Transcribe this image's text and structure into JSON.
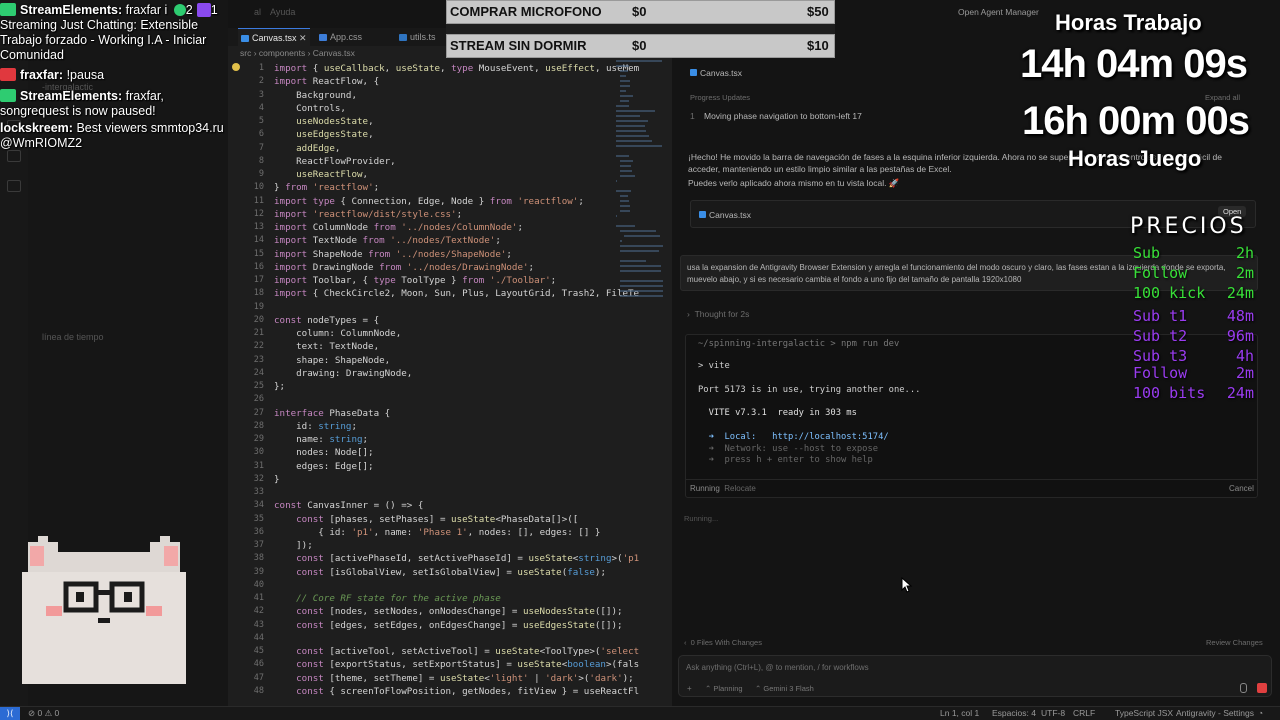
{
  "window": {
    "menu_help": "Ayuda",
    "menu_al": "al",
    "open_agent_manager": "Open Agent Manager"
  },
  "tabs": [
    {
      "label": "Canvas.tsx",
      "active": true
    },
    {
      "label": "App.css",
      "active": false
    },
    {
      "label": "utils.ts",
      "active": false
    }
  ],
  "breadcrumb": [
    "src",
    "components",
    "Canvas.tsx"
  ],
  "sidebar": {
    "timeline": "línea de tiempo",
    "project": "-intergalactic"
  },
  "editor": {
    "line_numbers": [
      1,
      2,
      3,
      4,
      5,
      6,
      7,
      8,
      9,
      10,
      11,
      12,
      13,
      14,
      15,
      16,
      17,
      18,
      19,
      20,
      21,
      22,
      23,
      24,
      25,
      26,
      27,
      28,
      29,
      30,
      31,
      32,
      33,
      34,
      35,
      36,
      37,
      38,
      39,
      40,
      41,
      42,
      43,
      44,
      45,
      46,
      47,
      48
    ],
    "code_lines": [
      "import { useCallback, useState, type MouseEvent, useEffect, useMem",
      "import ReactFlow, {",
      "    Background,",
      "    Controls,",
      "    useNodesState,",
      "    useEdgesState,",
      "    addEdge,",
      "    ReactFlowProvider,",
      "    useReactFlow,",
      "} from 'reactflow';",
      "import type { Connection, Edge, Node } from 'reactflow';",
      "import 'reactflow/dist/style.css';",
      "import ColumnNode from '../nodes/ColumnNode';",
      "import TextNode from '../nodes/TextNode';",
      "import ShapeNode from '../nodes/ShapeNode';",
      "import DrawingNode from '../nodes/DrawingNode';",
      "import Toolbar, { type ToolType } from './Toolbar';",
      "import { CheckCircle2, Moon, Sun, Plus, LayoutGrid, Trash2, FileTe",
      "",
      "const nodeTypes = {",
      "    column: ColumnNode,",
      "    text: TextNode,",
      "    shape: ShapeNode,",
      "    drawing: DrawingNode,",
      "};",
      "",
      "interface PhaseData {",
      "    id: string;",
      "    name: string;",
      "    nodes: Node[];",
      "    edges: Edge[];",
      "}",
      "",
      "const CanvasInner = () => {",
      "    const [phases, setPhases] = useState<PhaseData[]>([",
      "        { id: 'p1', name: 'Phase 1', nodes: [], edges: [] }",
      "    ]);",
      "    const [activePhaseId, setActivePhaseId] = useState<string>('p1",
      "    const [isGlobalView, setIsGlobalView] = useState(false);",
      "",
      "    // Core RF state for the active phase",
      "    const [nodes, setNodes, onNodesChange] = useNodesState([]);",
      "    const [edges, setEdges, onEdgesChange] = useEdgesState([]);",
      "",
      "    const [activeTool, setActiveTool] = useState<ToolType>('select",
      "    const [exportStatus, setExportStatus] = useState<boolean>(fals",
      "    const [theme, setTheme] = useState<'light' | 'dark'>('dark');",
      "    const { screenToFlowPosition, getNodes, fitView } = useReactFl"
    ]
  },
  "chat": [
    {
      "user": "StreamElements:",
      "text": "fraxfar i",
      "badge_color": "#2ecc71"
    },
    {
      "user": "",
      "text": "Streaming Just Chatting: Extensible Trabajo forzado - Working I.A - Iniciar Comunidad"
    },
    {
      "user": "fraxfar:",
      "text": "!pausa",
      "badge_color": "#e0383e"
    },
    {
      "user": "StreamElements:",
      "text": "fraxfar, songrequest is now paused!",
      "badge_color": "#2ecc71"
    },
    {
      "user": "lockskreem:",
      "text": "Best viewers smmtop34.ru @WmRIOMZ2"
    }
  ],
  "chat_header_counts": {
    "a": "2",
    "b": "1"
  },
  "agent": {
    "file_chip": "Canvas.tsx",
    "progress_title": "Progress Updates",
    "expand_all": "Expand all",
    "progress_item_num": "1",
    "progress_item": "Moving phase navigation to bottom-left 17",
    "message": "¡Hecho! He movido la barra de navegación de fases a la esquina inferior izquierda. Ahora no se superpone con los controles y es más fácil de acceder, manteniendo un estilo limpio similar a las pestañas de Excel.",
    "message2": "Puedes verlo aplicado ahora mismo en tu vista local. 🚀",
    "card_file": "Canvas.tsx",
    "open_button": "Open",
    "user_prompt": "usa la expansion de Antigravity Browser Extension y arregla el funcionamiento del modo oscuro y claro, las fases estan a la izquierda donde se exporta, muevelo abajo, y si es necesario cambia el fondo a uno fijo del tamaño de pantalla 1920x1080",
    "thought": "Thought for 2s",
    "terminal": {
      "path": "~/spinning-intergalactic",
      "command": "npm run dev",
      "lines": [
        "> vite",
        "",
        "Port 5173 is in use, trying another one...",
        "",
        "  VITE v7.3.1  ready in 303 ms",
        "",
        "  ➜  Local:   http://localhost:5174/",
        "  ➜  Network: use --host to expose",
        "  ➜  press h + enter to show help"
      ],
      "status": "Running",
      "relocate": "Relocate",
      "cancel": "Cancel"
    },
    "running": "Running...",
    "files_changed": "0 Files With Changes",
    "review_changes": "Review Changes",
    "input_placeholder": "Ask anything (Ctrl+L), @ to mention, / for workflows",
    "mode": "Planning",
    "model": "Gemini 3 Flash"
  },
  "banners": [
    {
      "label": "COMPRAR MICROFONO",
      "raised": "$0",
      "goal": "$50"
    },
    {
      "label": "STREAM SIN DORMIR",
      "raised": "$0",
      "goal": "$10"
    }
  ],
  "overlay": {
    "work_label": "Horas Trabajo",
    "work_time": "14h 04m 09s",
    "play_time": "16h 00m 00s",
    "play_label": "Horas Juego",
    "prices_title": "PRECIOS",
    "prices_green": [
      {
        "item": "Sub",
        "value": "2h"
      },
      {
        "item": "Follow",
        "value": "2m"
      },
      {
        "item": "100 kick",
        "value": "24m"
      }
    ],
    "prices_purple": [
      {
        "item": "Sub t1",
        "value": "48m"
      },
      {
        "item": "Sub t2",
        "value": "96m"
      },
      {
        "item": "Sub t3",
        "value": "4h"
      },
      {
        "item": "Follow",
        "value": "2m"
      },
      {
        "item": "100 bits",
        "value": "24m"
      }
    ],
    "green": "#38e038",
    "purple": "#9a3cf0"
  },
  "statusbar": {
    "problems": "⊘ 0 ⚠ 0",
    "position": "Ln 1, col 1",
    "spaces": "Espacios: 4",
    "encoding": "UTF-8",
    "eol": "CRLF",
    "language": "TypeScript JSX",
    "settings": "Antigravity - Settings"
  }
}
